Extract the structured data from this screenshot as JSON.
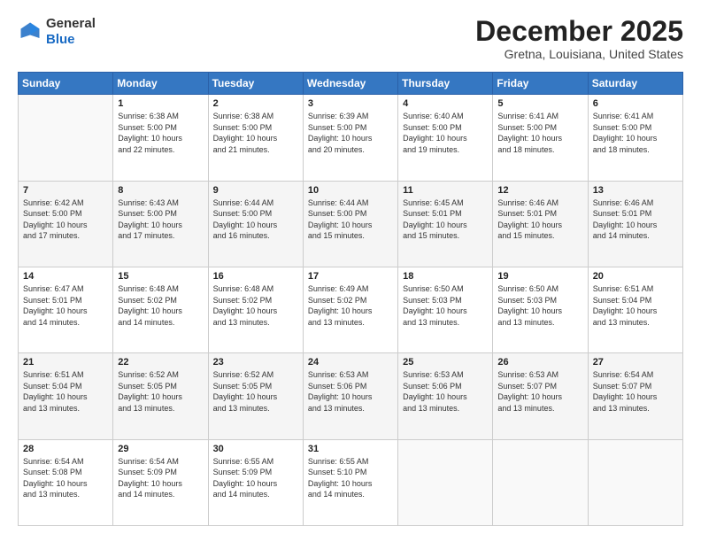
{
  "header": {
    "logo": {
      "general": "General",
      "blue": "Blue"
    },
    "title": "December 2025",
    "subtitle": "Gretna, Louisiana, United States"
  },
  "weekdays": [
    "Sunday",
    "Monday",
    "Tuesday",
    "Wednesday",
    "Thursday",
    "Friday",
    "Saturday"
  ],
  "weeks": [
    [
      {
        "day": "",
        "info": ""
      },
      {
        "day": "1",
        "info": "Sunrise: 6:38 AM\nSunset: 5:00 PM\nDaylight: 10 hours\nand 22 minutes."
      },
      {
        "day": "2",
        "info": "Sunrise: 6:38 AM\nSunset: 5:00 PM\nDaylight: 10 hours\nand 21 minutes."
      },
      {
        "day": "3",
        "info": "Sunrise: 6:39 AM\nSunset: 5:00 PM\nDaylight: 10 hours\nand 20 minutes."
      },
      {
        "day": "4",
        "info": "Sunrise: 6:40 AM\nSunset: 5:00 PM\nDaylight: 10 hours\nand 19 minutes."
      },
      {
        "day": "5",
        "info": "Sunrise: 6:41 AM\nSunset: 5:00 PM\nDaylight: 10 hours\nand 18 minutes."
      },
      {
        "day": "6",
        "info": "Sunrise: 6:41 AM\nSunset: 5:00 PM\nDaylight: 10 hours\nand 18 minutes."
      }
    ],
    [
      {
        "day": "7",
        "info": "Sunrise: 6:42 AM\nSunset: 5:00 PM\nDaylight: 10 hours\nand 17 minutes."
      },
      {
        "day": "8",
        "info": "Sunrise: 6:43 AM\nSunset: 5:00 PM\nDaylight: 10 hours\nand 17 minutes."
      },
      {
        "day": "9",
        "info": "Sunrise: 6:44 AM\nSunset: 5:00 PM\nDaylight: 10 hours\nand 16 minutes."
      },
      {
        "day": "10",
        "info": "Sunrise: 6:44 AM\nSunset: 5:00 PM\nDaylight: 10 hours\nand 15 minutes."
      },
      {
        "day": "11",
        "info": "Sunrise: 6:45 AM\nSunset: 5:01 PM\nDaylight: 10 hours\nand 15 minutes."
      },
      {
        "day": "12",
        "info": "Sunrise: 6:46 AM\nSunset: 5:01 PM\nDaylight: 10 hours\nand 15 minutes."
      },
      {
        "day": "13",
        "info": "Sunrise: 6:46 AM\nSunset: 5:01 PM\nDaylight: 10 hours\nand 14 minutes."
      }
    ],
    [
      {
        "day": "14",
        "info": "Sunrise: 6:47 AM\nSunset: 5:01 PM\nDaylight: 10 hours\nand 14 minutes."
      },
      {
        "day": "15",
        "info": "Sunrise: 6:48 AM\nSunset: 5:02 PM\nDaylight: 10 hours\nand 14 minutes."
      },
      {
        "day": "16",
        "info": "Sunrise: 6:48 AM\nSunset: 5:02 PM\nDaylight: 10 hours\nand 13 minutes."
      },
      {
        "day": "17",
        "info": "Sunrise: 6:49 AM\nSunset: 5:02 PM\nDaylight: 10 hours\nand 13 minutes."
      },
      {
        "day": "18",
        "info": "Sunrise: 6:50 AM\nSunset: 5:03 PM\nDaylight: 10 hours\nand 13 minutes."
      },
      {
        "day": "19",
        "info": "Sunrise: 6:50 AM\nSunset: 5:03 PM\nDaylight: 10 hours\nand 13 minutes."
      },
      {
        "day": "20",
        "info": "Sunrise: 6:51 AM\nSunset: 5:04 PM\nDaylight: 10 hours\nand 13 minutes."
      }
    ],
    [
      {
        "day": "21",
        "info": "Sunrise: 6:51 AM\nSunset: 5:04 PM\nDaylight: 10 hours\nand 13 minutes."
      },
      {
        "day": "22",
        "info": "Sunrise: 6:52 AM\nSunset: 5:05 PM\nDaylight: 10 hours\nand 13 minutes."
      },
      {
        "day": "23",
        "info": "Sunrise: 6:52 AM\nSunset: 5:05 PM\nDaylight: 10 hours\nand 13 minutes."
      },
      {
        "day": "24",
        "info": "Sunrise: 6:53 AM\nSunset: 5:06 PM\nDaylight: 10 hours\nand 13 minutes."
      },
      {
        "day": "25",
        "info": "Sunrise: 6:53 AM\nSunset: 5:06 PM\nDaylight: 10 hours\nand 13 minutes."
      },
      {
        "day": "26",
        "info": "Sunrise: 6:53 AM\nSunset: 5:07 PM\nDaylight: 10 hours\nand 13 minutes."
      },
      {
        "day": "27",
        "info": "Sunrise: 6:54 AM\nSunset: 5:07 PM\nDaylight: 10 hours\nand 13 minutes."
      }
    ],
    [
      {
        "day": "28",
        "info": "Sunrise: 6:54 AM\nSunset: 5:08 PM\nDaylight: 10 hours\nand 13 minutes."
      },
      {
        "day": "29",
        "info": "Sunrise: 6:54 AM\nSunset: 5:09 PM\nDaylight: 10 hours\nand 14 minutes."
      },
      {
        "day": "30",
        "info": "Sunrise: 6:55 AM\nSunset: 5:09 PM\nDaylight: 10 hours\nand 14 minutes."
      },
      {
        "day": "31",
        "info": "Sunrise: 6:55 AM\nSunset: 5:10 PM\nDaylight: 10 hours\nand 14 minutes."
      },
      {
        "day": "",
        "info": ""
      },
      {
        "day": "",
        "info": ""
      },
      {
        "day": "",
        "info": ""
      }
    ]
  ]
}
